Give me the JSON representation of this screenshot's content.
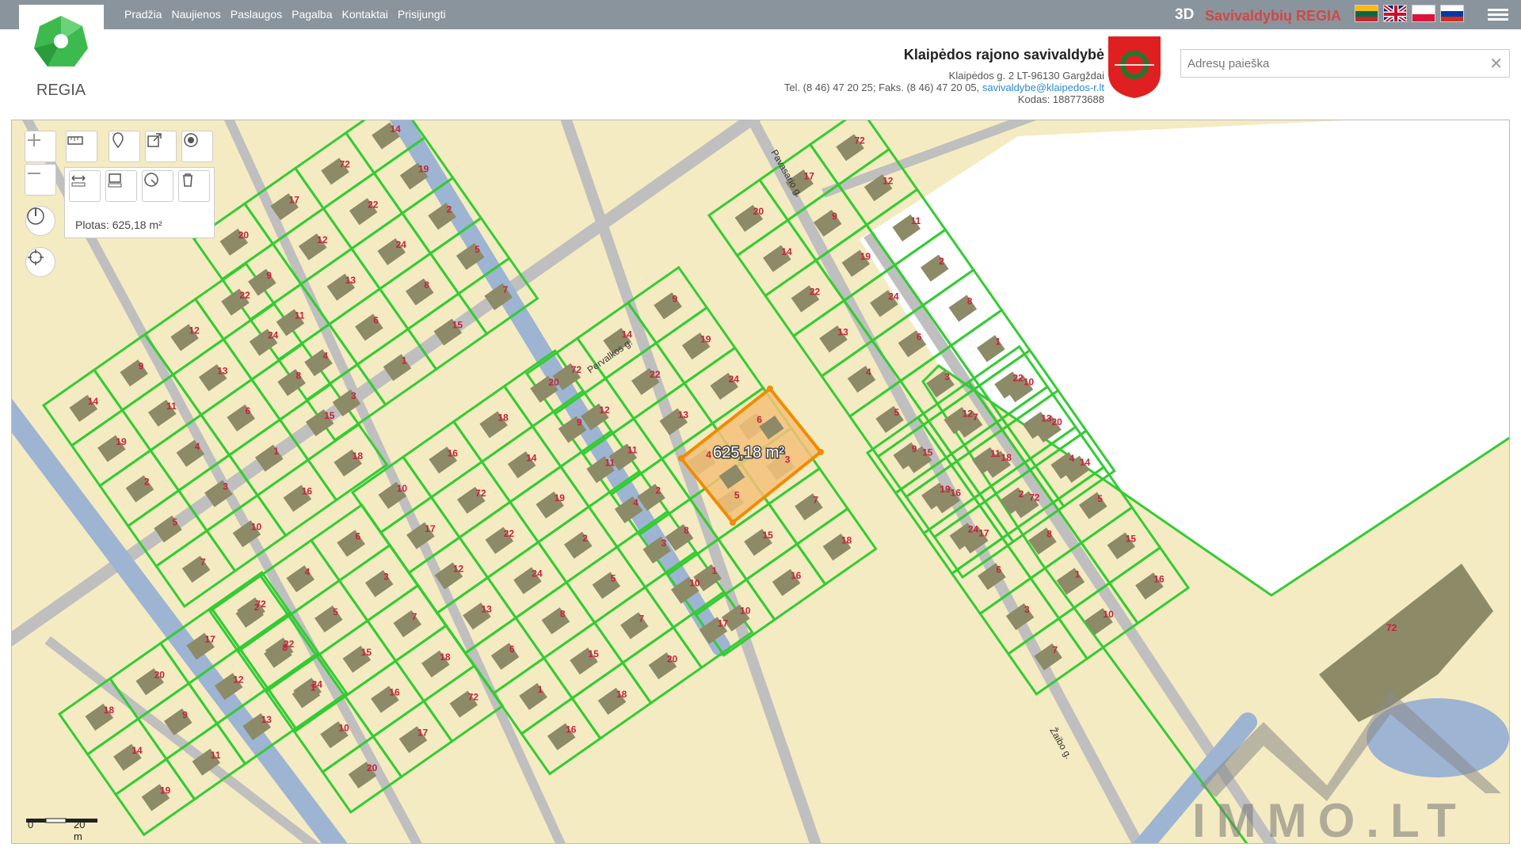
{
  "nav": [
    "Pradžia",
    "Naujienos",
    "Paslaugos",
    "Pagalba",
    "Kontaktai",
    "Prisijungti"
  ],
  "brand": {
    "prefix": "3D",
    "name": "Savivaldybių REGIA"
  },
  "logo_text": "REGIA",
  "flags": [
    "lt-flag-icon",
    "uk-flag-icon",
    "pl-flag-icon",
    "ru-flag-icon"
  ],
  "municipality": {
    "title": "Klaipėdos rajono savivaldybė",
    "address": "Klaipėdos g. 2 LT-96130 Gargždai",
    "phone": "Tel. (8 46) 47 20 25; Faks. (8 46) 47 20 05,",
    "email": "savivaldybe@klaipedos-r.lt",
    "code": "Kodas: 188773688"
  },
  "search": {
    "placeholder": "Adresų paieška",
    "value": "",
    "clear": "✕"
  },
  "tools": {
    "area_text": "Plotas: 625,18 m²",
    "selected_area": "625,18 m²"
  },
  "scale": {
    "zero": "0",
    "label": "20 m"
  },
  "watermark": "IMMO.LT",
  "streets": [
    {
      "name": "Pervalkos g."
    },
    {
      "name": "Pavasario g."
    },
    {
      "name": "Žaibo g."
    }
  ],
  "house_numbers": [
    "14",
    "9",
    "12",
    "22",
    "19",
    "11",
    "13",
    "24",
    "2",
    "4",
    "6",
    "8",
    "5",
    "3",
    "1",
    "15",
    "7",
    "10",
    "16",
    "18",
    "20",
    "17",
    "72"
  ],
  "colors": {
    "parcel": "#33cc33",
    "water": "#9db4d2",
    "road": "#c8c8c8",
    "building": "#8d8a68",
    "selection": "#f5a623",
    "land": "#f5ebc2"
  }
}
